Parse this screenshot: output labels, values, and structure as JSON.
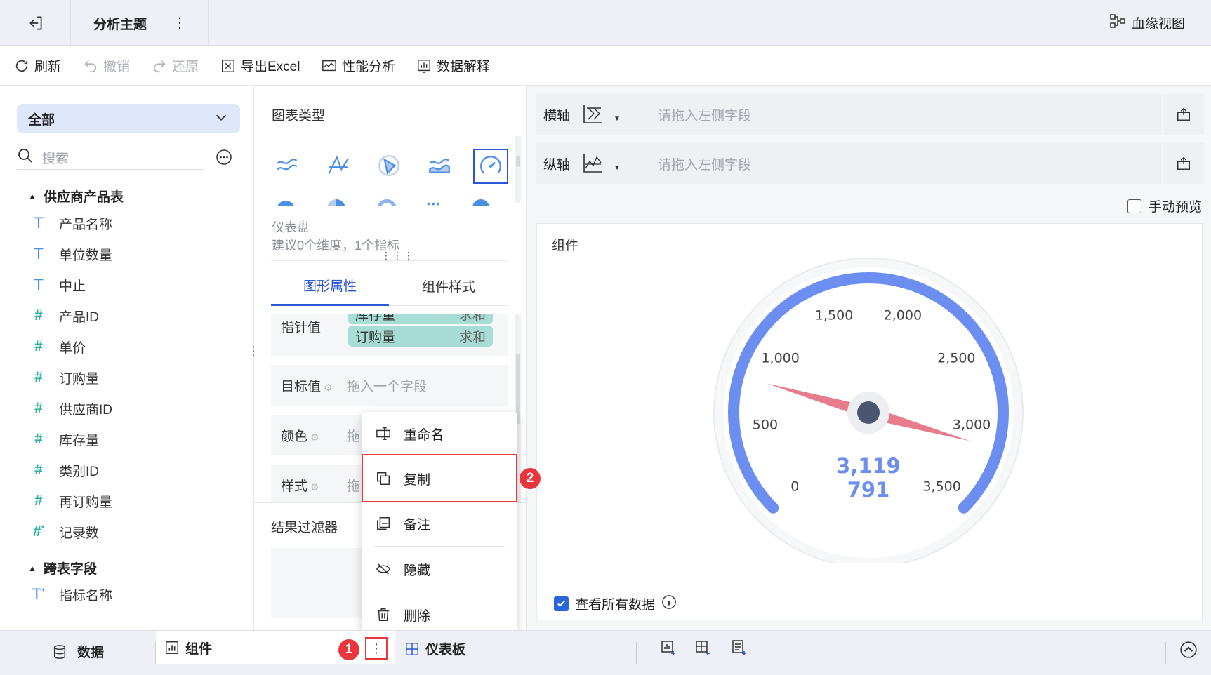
{
  "header": {
    "title": "分析主题",
    "lineage_label": "血缘视图"
  },
  "toolbar": {
    "refresh": "刷新",
    "undo": "撤销",
    "redo": "还原",
    "export": "导出Excel",
    "perf": "性能分析",
    "explain": "数据解释"
  },
  "left": {
    "dropdown_value": "全部",
    "search_placeholder": "搜索",
    "groups": [
      {
        "title": "供应商产品表",
        "fields": [
          {
            "type": "T",
            "label": "产品名称"
          },
          {
            "type": "T",
            "label": "单位数量"
          },
          {
            "type": "T",
            "label": "中止"
          },
          {
            "type": "#",
            "label": "产品ID"
          },
          {
            "type": "#",
            "label": "单价"
          },
          {
            "type": "#",
            "label": "订购量"
          },
          {
            "type": "#",
            "label": "供应商ID"
          },
          {
            "type": "#",
            "label": "库存量"
          },
          {
            "type": "#",
            "label": "类别ID"
          },
          {
            "type": "#",
            "label": "再订购量"
          },
          {
            "type": "#*",
            "label": "记录数"
          }
        ]
      },
      {
        "title": "跨表字段",
        "fields": [
          {
            "type": "T*",
            "label": "指标名称"
          }
        ]
      }
    ]
  },
  "middle": {
    "chart_type_title": "图表类型",
    "selected_chart_name": "仪表盘",
    "selected_chart_hint": "建议0个维度，1个指标",
    "tabs": [
      "图形属性",
      "组件样式"
    ],
    "pointer_label": "指针值",
    "pointer_fields": [
      {
        "name": "库存量",
        "agg": "求和"
      },
      {
        "name": "订购量",
        "agg": "求和"
      }
    ],
    "target_label": "目标值",
    "target_placeholder": "拖入一个字段",
    "color_label": "颜色",
    "color_placeholder": "拖",
    "style_label": "样式",
    "style_placeholder": "拖",
    "filter_title": "结果过滤器"
  },
  "menu": {
    "items": [
      "重命名",
      "复制",
      "备注",
      "隐藏",
      "删除"
    ]
  },
  "badges": {
    "one": "1",
    "two": "2"
  },
  "right": {
    "x_axis_label": "横轴",
    "y_axis_label": "纵轴",
    "axis_placeholder": "请拖入左侧字段",
    "manual_preview": "手动预览",
    "component_title": "组件",
    "view_all": "查看所有数据"
  },
  "bottom": {
    "data_tab": "数据",
    "component_tab": "组件",
    "dashboard_tab": "仪表板"
  },
  "chart_data": {
    "type": "gauge",
    "min": 0,
    "max": 3500,
    "ticks": [
      "0",
      "500",
      "1,000",
      "1,500",
      "2,000",
      "2,500",
      "3,000",
      "3,500"
    ],
    "values": [
      3119,
      791
    ],
    "value_labels": [
      "3,119",
      "791"
    ],
    "colors": {
      "arc": "#6b8ef0",
      "needle": "#e87c8c",
      "hub": "#4a5670"
    }
  }
}
